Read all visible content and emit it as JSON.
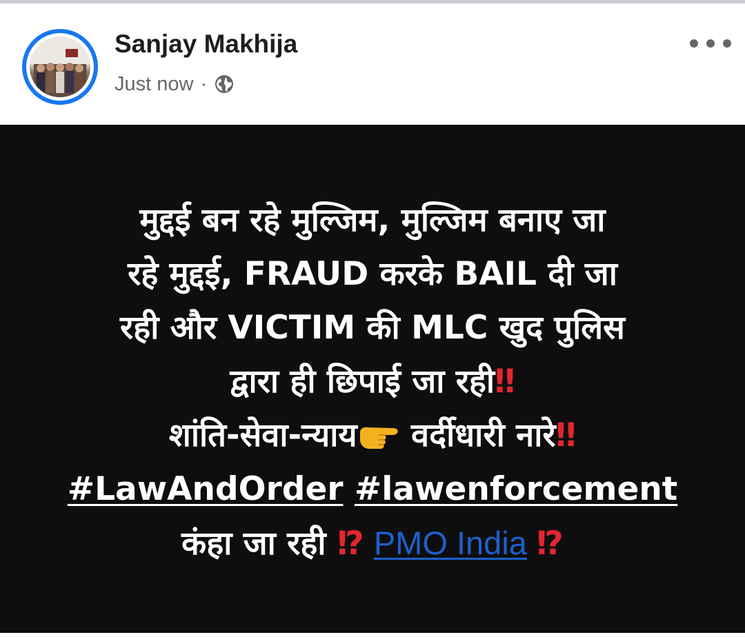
{
  "post": {
    "author": "Sanjay Makhija",
    "timestamp": "Just now",
    "meta_separator": "·",
    "audience_icon": "globe-icon",
    "more_icon": "more-dots-icon",
    "lines": [
      "मुद्दई बन रहे मुल्जिम, मुल्जिम बनाए जा",
      "रहे मुद्दई, FRAUD करके BAIL दी जा",
      "रही और VICTIM की MLC खुद पुलिस",
      "द्वारा ही छिपाई जा रही"
    ],
    "line4_mark": "‼",
    "line5_text": "शांति-सेवा-न्याय",
    "line5_emoji": "backhand-index-pointing-right-icon",
    "line5_text2": " वर्दीधारी नारे",
    "line5_mark": "‼",
    "hashtag1": "#LawAndOrder",
    "hashtag2": "#lawenforcement",
    "line7_text": "कंहा जा रही ",
    "line7_mark1": "⁉",
    "mention": "PMO India",
    "line7_mark2": "⁉"
  },
  "colors": {
    "accent_blue": "#1877f2",
    "post_background": "#0e0e0e",
    "exclamation_red": "#e3262e",
    "mention_blue": "#1f5fcc"
  }
}
